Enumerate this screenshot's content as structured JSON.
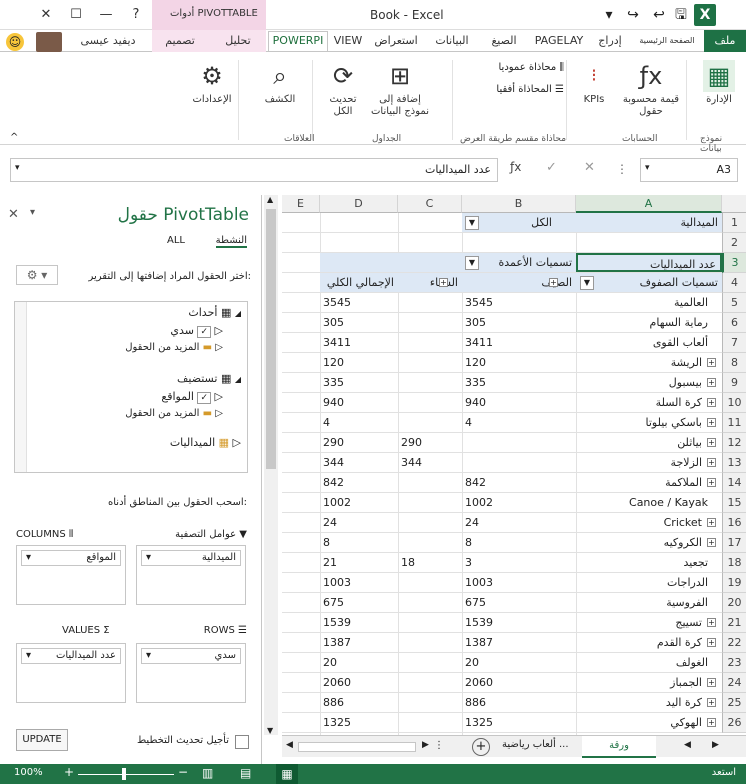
{
  "window": {
    "title": "Book - Excel",
    "context_title": "أدوات PIVOTTABLE",
    "controls": [
      "✕",
      "☐",
      "—",
      "?"
    ]
  },
  "tabs": {
    "file": "ملف",
    "home": "الصفحة الرئيسية",
    "insert": "إدراج",
    "pagelayout": "PAGELAY",
    "formulas": "الصيغ",
    "data": "البيانات",
    "review": "استعراض",
    "view": "VIEW",
    "powerpivot": "POWERPI",
    "analyze": "تحليل",
    "design": "تصميم",
    "user": "ديفيد عيسى"
  },
  "ribbon": {
    "groups": {
      "data_model": "نموذج بيانات",
      "calculations": "الحسابات",
      "layout": "محاذاة مقسم طريقة العرض",
      "tables": "الجداول",
      "relationships": "العلاقات"
    },
    "buttons": {
      "manage": "الإدارة",
      "measure": "قيمة محسوبة حقول",
      "kpis": "KPIs",
      "align_vertical": "محاذاة عموديا",
      "align_horizontal": "المحاذاة أفقيا",
      "add_to_model": "إضافة إلى نموذج البيانات",
      "update_all": "تحديث الكل",
      "detect": "الكشف",
      "settings": "الإعدادات"
    }
  },
  "formula_bar": {
    "name_box": "A3",
    "value": "عدد الميداليات"
  },
  "pivot_pane": {
    "title": "حقول PivotTable",
    "tab_all": "ALL",
    "tab_active": "النشطة",
    "choose_label": "اختر الحقول المراد إضافتها إلى التقرير:",
    "tables": [
      {
        "name": "أحداث",
        "fields": [
          "سدي",
          "المزيد من الحقول"
        ]
      },
      {
        "name": "تستضيف",
        "fields": [
          "المواقع",
          "المزيد من الحقول"
        ]
      },
      {
        "name": "الميداليات",
        "fields": []
      }
    ],
    "drag_label": "اسحب الحقول بين المناطق أدناه:",
    "areas": {
      "filters": {
        "label": "عوامل التصفية",
        "items": [
          "الميدالية"
        ]
      },
      "columns": {
        "label": "COLUMNS",
        "items": [
          "المواقع"
        ]
      },
      "rows": {
        "label": "ROWS",
        "items": [
          "سدي"
        ]
      },
      "values": {
        "label": "VALUES",
        "items": [
          "عدد الميداليات"
        ]
      }
    },
    "defer_label": "تأجيل تحديث التخطيط",
    "update_button": "UPDATE"
  },
  "grid": {
    "columns": [
      "A",
      "B",
      "C",
      "D",
      "E"
    ],
    "filter_row": {
      "label": "الميدالية",
      "value": "الكل"
    },
    "header_row": {
      "values_label": "عدد الميداليات",
      "col_labels": "تسميات الأعمدة"
    },
    "subheader": {
      "row_labels": "تسميات الصفوف",
      "summer": "الصيف",
      "winter": "الشتاء",
      "total": "الإجمالي الكلي"
    },
    "rows": [
      {
        "n": "5",
        "label": "العالمية",
        "exp": false,
        "b": "3545",
        "c": "",
        "d": "3545"
      },
      {
        "n": "6",
        "label": "رماية السهام",
        "exp": false,
        "b": "305",
        "c": "",
        "d": "305"
      },
      {
        "n": "7",
        "label": "ألعاب القوى",
        "exp": false,
        "b": "3411",
        "c": "",
        "d": "3411"
      },
      {
        "n": "8",
        "label": "الريشة",
        "exp": true,
        "b": "120",
        "c": "",
        "d": "120"
      },
      {
        "n": "9",
        "label": "بيسبول",
        "exp": true,
        "b": "335",
        "c": "",
        "d": "335"
      },
      {
        "n": "10",
        "label": "كرة السلة",
        "exp": true,
        "b": "940",
        "c": "",
        "d": "940"
      },
      {
        "n": "11",
        "label": "باسكي بيلوتا",
        "exp": true,
        "b": "4",
        "c": "",
        "d": "4"
      },
      {
        "n": "12",
        "label": "بياثلن",
        "exp": true,
        "b": "",
        "c": "290",
        "d": "290"
      },
      {
        "n": "13",
        "label": "الزلاجة",
        "exp": true,
        "b": "",
        "c": "344",
        "d": "344"
      },
      {
        "n": "14",
        "label": "الملاكمة",
        "exp": true,
        "b": "842",
        "c": "",
        "d": "842"
      },
      {
        "n": "15",
        "label": "Canoe / Kayak",
        "exp": false,
        "b": "1002",
        "c": "",
        "d": "1002"
      },
      {
        "n": "16",
        "label": "Cricket",
        "exp": true,
        "b": "24",
        "c": "",
        "d": "24"
      },
      {
        "n": "17",
        "label": "الكروكيه",
        "exp": true,
        "b": "8",
        "c": "",
        "d": "8"
      },
      {
        "n": "18",
        "label": "تجعيد",
        "exp": false,
        "b": "3",
        "c": "18",
        "d": "21"
      },
      {
        "n": "19",
        "label": "الدراجات",
        "exp": false,
        "b": "1003",
        "c": "",
        "d": "1003"
      },
      {
        "n": "20",
        "label": "الفروسية",
        "exp": false,
        "b": "675",
        "c": "",
        "d": "675"
      },
      {
        "n": "21",
        "label": "تسييج",
        "exp": true,
        "b": "1539",
        "c": "",
        "d": "1539"
      },
      {
        "n": "22",
        "label": "كرة القدم",
        "exp": true,
        "b": "1387",
        "c": "",
        "d": "1387"
      },
      {
        "n": "23",
        "label": "الغولف",
        "exp": false,
        "b": "20",
        "c": "",
        "d": "20"
      },
      {
        "n": "24",
        "label": "الجمباز",
        "exp": true,
        "b": "2060",
        "c": "",
        "d": "2060"
      },
      {
        "n": "25",
        "label": "كرة اليد",
        "exp": true,
        "b": "886",
        "c": "",
        "d": "886"
      },
      {
        "n": "26",
        "label": "الهوكي",
        "exp": true,
        "b": "1325",
        "c": "",
        "d": "1325"
      }
    ]
  },
  "sheets": {
    "active": "ورقة",
    "other": "ألعاب رياضية ..."
  },
  "status": {
    "ready": "استعد",
    "zoom": "100%"
  },
  "colors": {
    "excel_green": "#217346",
    "pivot_pink": "#f3d5e6",
    "pivot_header": "#dde8f5"
  }
}
